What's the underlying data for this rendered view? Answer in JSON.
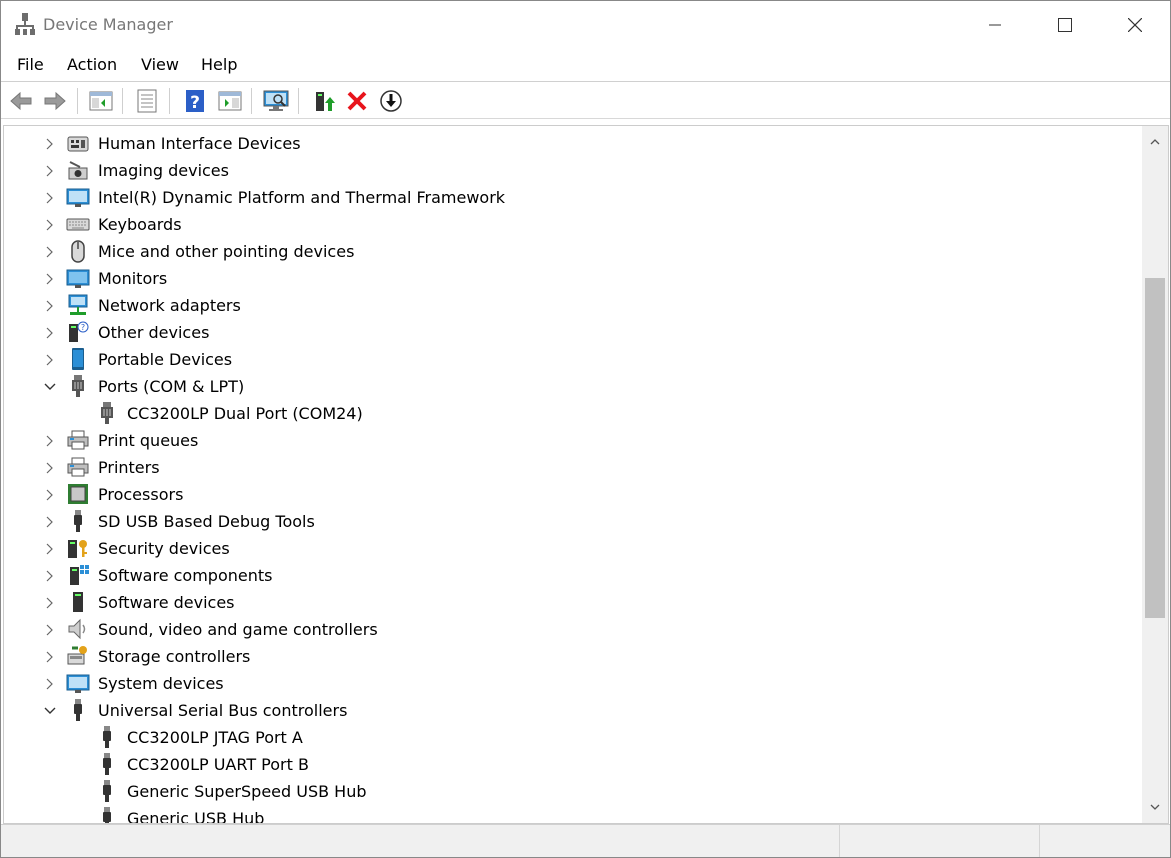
{
  "window": {
    "title": "Device Manager"
  },
  "menu": [
    "File",
    "Action",
    "View",
    "Help"
  ],
  "toolbar": {
    "buttons": [
      "back-icon",
      "forward-icon",
      "show-hide-console-tree-icon",
      "properties-icon",
      "help-icon",
      "action-pane-icon",
      "scan-hardware-icon",
      "update-driver-icon",
      "uninstall-icon",
      "disable-device-icon"
    ]
  },
  "tree": {
    "rows": [
      {
        "label": "Human Interface Devices",
        "level": 0,
        "expanded": false,
        "icon": "hid-icon"
      },
      {
        "label": "Imaging devices",
        "level": 0,
        "expanded": false,
        "icon": "camera-icon"
      },
      {
        "label": "Intel(R) Dynamic Platform and Thermal Framework",
        "level": 0,
        "expanded": false,
        "icon": "computer-icon"
      },
      {
        "label": "Keyboards",
        "level": 0,
        "expanded": false,
        "icon": "keyboard-icon"
      },
      {
        "label": "Mice and other pointing devices",
        "level": 0,
        "expanded": false,
        "icon": "mouse-icon"
      },
      {
        "label": "Monitors",
        "level": 0,
        "expanded": false,
        "icon": "monitor-icon"
      },
      {
        "label": "Network adapters",
        "level": 0,
        "expanded": false,
        "icon": "network-icon"
      },
      {
        "label": "Other devices",
        "level": 0,
        "expanded": false,
        "icon": "unknown-device-icon"
      },
      {
        "label": "Portable Devices",
        "level": 0,
        "expanded": false,
        "icon": "portable-device-icon"
      },
      {
        "label": "Ports (COM & LPT)",
        "level": 0,
        "expanded": true,
        "icon": "port-icon"
      },
      {
        "label": "CC3200LP Dual Port (COM24)",
        "level": 1,
        "expanded": null,
        "icon": "port-icon"
      },
      {
        "label": "Print queues",
        "level": 0,
        "expanded": false,
        "icon": "printer-icon"
      },
      {
        "label": "Printers",
        "level": 0,
        "expanded": false,
        "icon": "printer-icon"
      },
      {
        "label": "Processors",
        "level": 0,
        "expanded": false,
        "icon": "processor-icon"
      },
      {
        "label": "SD USB Based Debug Tools",
        "level": 0,
        "expanded": false,
        "icon": "usb-icon"
      },
      {
        "label": "Security devices",
        "level": 0,
        "expanded": false,
        "icon": "security-icon"
      },
      {
        "label": "Software components",
        "level": 0,
        "expanded": false,
        "icon": "software-component-icon"
      },
      {
        "label": "Software devices",
        "level": 0,
        "expanded": false,
        "icon": "software-device-icon"
      },
      {
        "label": "Sound, video and game controllers",
        "level": 0,
        "expanded": false,
        "icon": "speaker-icon"
      },
      {
        "label": "Storage controllers",
        "level": 0,
        "expanded": false,
        "icon": "storage-icon"
      },
      {
        "label": "System devices",
        "level": 0,
        "expanded": false,
        "icon": "computer-icon"
      },
      {
        "label": "Universal Serial Bus controllers",
        "level": 0,
        "expanded": true,
        "icon": "usb-icon"
      },
      {
        "label": "CC3200LP JTAG Port A",
        "level": 1,
        "expanded": null,
        "icon": "usb-icon"
      },
      {
        "label": "CC3200LP UART Port B",
        "level": 1,
        "expanded": null,
        "icon": "usb-icon"
      },
      {
        "label": "Generic SuperSpeed USB Hub",
        "level": 1,
        "expanded": null,
        "icon": "usb-icon"
      },
      {
        "label": "Generic USB Hub",
        "level": 1,
        "expanded": null,
        "icon": "usb-icon"
      }
    ]
  },
  "colors": {
    "uninstall": "#e8141c",
    "update": "#1f9d2a",
    "help": "#2b5fc7",
    "monitor": "#2c8fd6"
  }
}
